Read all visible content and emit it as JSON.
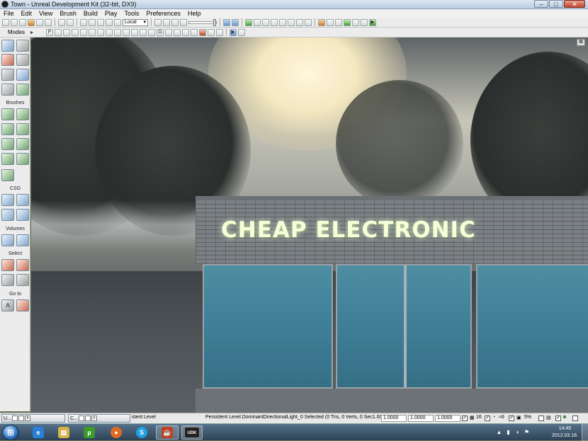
{
  "window": {
    "title": "Town - Unreal Development Kit (32-bit, DX9)",
    "buttons": [
      "–",
      "□",
      "✕"
    ]
  },
  "menu": [
    "File",
    "Edit",
    "View",
    "Brush",
    "Build",
    "Play",
    "Tools",
    "Preferences",
    "Help"
  ],
  "toolbar": {
    "coord_system": "Local",
    "modes_label": "Modes",
    "mode_letters": [
      "P",
      "G"
    ]
  },
  "left_panel": {
    "sections": [
      "Brushes",
      "CSG",
      "Volumes",
      "Select",
      "Go to"
    ],
    "goto_letters": [
      "A"
    ]
  },
  "viewport": {
    "sign_text": "CHEAP ELECTRONIC",
    "maximize_glyph": "⧉"
  },
  "statusbar": {
    "mini_windows": [
      "U...",
      "C..."
    ],
    "level_label": "stent Level",
    "selection": "Persistent Level.DominantDirectionalLight_0 Selected (0 Tris, 0 Verts, 0 Sec1.0000",
    "drag_x": "1.0000",
    "drag_y": "1.0000",
    "drag_z": "1.0000",
    "grid_size": "16",
    "rotation": "≈6",
    "scale_pct": "5%"
  },
  "taskbar": {
    "apps": [
      {
        "icon": "internet-explorer-icon",
        "glyph": "e",
        "color": "#2a7fd6"
      },
      {
        "icon": "file-explorer-icon",
        "glyph": "▤",
        "color": "#d8b048"
      },
      {
        "icon": "utorrent-icon",
        "glyph": "µ",
        "color": "#3a9a2a"
      },
      {
        "icon": "firefox-icon",
        "glyph": "●",
        "color": "#e06a20"
      },
      {
        "icon": "skype-icon",
        "glyph": "S",
        "color": "#1fa0e0"
      },
      {
        "icon": "java-icon",
        "glyph": "☕",
        "color": "#c04020"
      },
      {
        "icon": "udk-icon",
        "glyph": "UDK",
        "color": "#222"
      }
    ],
    "time": "14:45",
    "date": "2012.03.16."
  },
  "colors": {
    "sign": "#f6ffd8",
    "glass": "#3f7f96",
    "brick": "#7b8084"
  }
}
